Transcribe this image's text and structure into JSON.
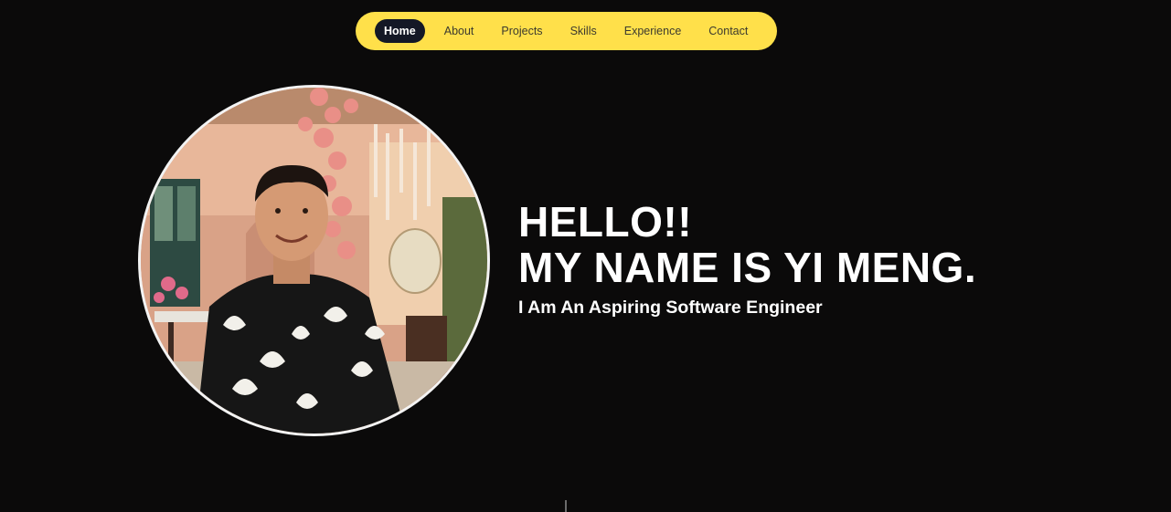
{
  "nav": {
    "items": [
      {
        "label": "Home",
        "active": true
      },
      {
        "label": "About",
        "active": false
      },
      {
        "label": "Projects",
        "active": false
      },
      {
        "label": "Skills",
        "active": false
      },
      {
        "label": "Experience",
        "active": false
      },
      {
        "label": "Contact",
        "active": false
      }
    ],
    "bg_color": "#ffe04a",
    "active_color": "#141826"
  },
  "hero": {
    "greeting": "HELLO!!",
    "name_line": "MY NAME IS YI MENG.",
    "subtitle": "I Am An Aspiring Software Engineer"
  },
  "colors": {
    "page_bg": "#0b0a0a",
    "text": "#ffffff"
  }
}
